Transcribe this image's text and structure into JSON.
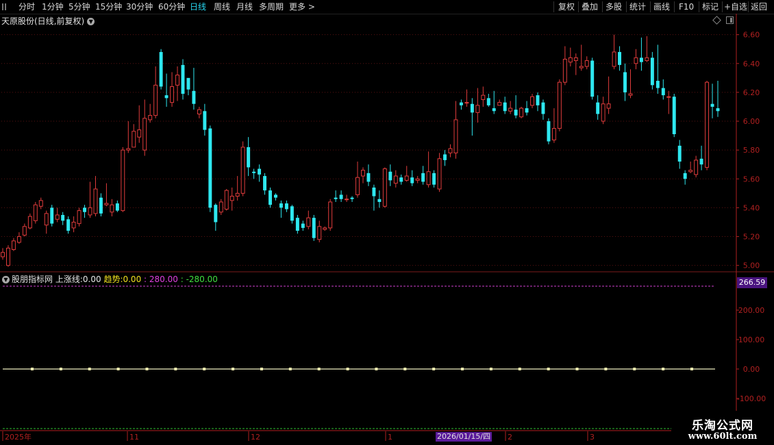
{
  "toolbar": {
    "left": [
      {
        "id": "fenshi",
        "label": "分时"
      },
      {
        "id": "1min",
        "label": "1分钟"
      },
      {
        "id": "5min",
        "label": "5分钟"
      },
      {
        "id": "15min",
        "label": "15分钟"
      },
      {
        "id": "30min",
        "label": "30分钟"
      },
      {
        "id": "60min",
        "label": "60分钟"
      },
      {
        "id": "day",
        "label": "日线",
        "active": true
      },
      {
        "id": "week",
        "label": "周线"
      },
      {
        "id": "month",
        "label": "月线"
      },
      {
        "id": "multi",
        "label": "多周期"
      },
      {
        "id": "more",
        "label": "更多 >"
      }
    ],
    "right": [
      {
        "id": "fuquan",
        "label": "复权"
      },
      {
        "id": "diejia",
        "label": "叠加"
      },
      {
        "id": "duogu",
        "label": "多股"
      },
      {
        "id": "tongji",
        "label": "统计"
      },
      {
        "id": "huaxian",
        "label": "画线"
      },
      {
        "id": "f10",
        "label": "F10"
      },
      {
        "id": "biaoji",
        "label": "标记"
      },
      {
        "id": "zixuan",
        "label": "+自选"
      },
      {
        "id": "fanhui",
        "label": "返回"
      }
    ]
  },
  "stock": {
    "title": "天原股份(日线,前复权)"
  },
  "indicator": {
    "name": "股朋指标网",
    "l1_label": "上涨线:",
    "l1_value": "0.00",
    "l2_label": "趋势:",
    "l2_value": "0.00",
    "l3_value": "280.00",
    "l4_value": "-280.00"
  },
  "indicator_tag": "266.59",
  "date_cursor": "2026/01/15/四",
  "watermark": {
    "title": "乐淘公式网",
    "url": "www.60lt.com"
  },
  "colors": {
    "up": "#e03c3c",
    "down": "#2ee8f0",
    "axis": "#b02020",
    "text": "#c8c8c8"
  },
  "chart_data": [
    {
      "type": "candlestick",
      "title": "",
      "y_ticks": [
        "6.60",
        "6.40",
        "6.20",
        "6.00",
        "5.80",
        "5.60",
        "5.40",
        "5.20",
        "5.00"
      ],
      "ylim": [
        4.97,
        6.66
      ],
      "x_labels": [
        "2025年",
        "11",
        "12",
        "1",
        "2",
        "3"
      ],
      "candles": [
        [
          5.06,
          5.09,
          5.04,
          5.12
        ],
        [
          5.0,
          5.12,
          4.99,
          5.14
        ],
        [
          5.11,
          5.17,
          5.1,
          5.19
        ],
        [
          5.16,
          5.2,
          5.15,
          5.23
        ],
        [
          5.21,
          5.27,
          5.2,
          5.29
        ],
        [
          5.26,
          5.34,
          5.25,
          5.36
        ],
        [
          5.31,
          5.42,
          5.29,
          5.44
        ],
        [
          5.41,
          5.45,
          5.39,
          5.47
        ],
        [
          5.28,
          5.36,
          5.22,
          5.38
        ],
        [
          5.4,
          5.29,
          5.27,
          5.42
        ],
        [
          5.32,
          5.35,
          5.3,
          5.4
        ],
        [
          5.35,
          5.31,
          5.28,
          5.37
        ],
        [
          5.32,
          5.24,
          5.22,
          5.34
        ],
        [
          5.26,
          5.3,
          5.23,
          5.34
        ],
        [
          5.29,
          5.38,
          5.27,
          5.4
        ],
        [
          5.4,
          5.37,
          5.33,
          5.42
        ],
        [
          5.35,
          5.4,
          5.33,
          5.58
        ],
        [
          5.36,
          5.53,
          5.34,
          5.62
        ],
        [
          5.47,
          5.36,
          5.34,
          5.5
        ],
        [
          5.42,
          5.43,
          5.41,
          5.57
        ],
        [
          5.37,
          5.42,
          5.34,
          5.46
        ],
        [
          5.43,
          5.38,
          5.37,
          5.45
        ],
        [
          5.38,
          5.8,
          5.37,
          5.82
        ],
        [
          5.8,
          5.81,
          5.78,
          6.0
        ],
        [
          5.82,
          5.93,
          5.82,
          5.98
        ],
        [
          5.89,
          5.94,
          5.85,
          6.11
        ],
        [
          5.8,
          6.02,
          5.76,
          6.15
        ],
        [
          6.01,
          6.04,
          5.99,
          6.12
        ],
        [
          6.04,
          6.25,
          6.02,
          6.38
        ],
        [
          6.48,
          6.24,
          6.22,
          6.5
        ],
        [
          6.18,
          6.16,
          6.1,
          6.33
        ],
        [
          6.13,
          6.24,
          6.1,
          6.34
        ],
        [
          6.25,
          6.32,
          6.14,
          6.38
        ],
        [
          6.39,
          6.19,
          6.15,
          6.43
        ],
        [
          6.3,
          6.22,
          6.18,
          6.26
        ],
        [
          6.21,
          6.12,
          6.08,
          6.37
        ],
        [
          6.05,
          6.08,
          6.02,
          6.1
        ],
        [
          6.07,
          5.94,
          5.9,
          6.12
        ],
        [
          5.95,
          5.4,
          5.37,
          5.97
        ],
        [
          5.42,
          5.3,
          5.24,
          5.43
        ],
        [
          5.37,
          5.44,
          5.35,
          5.46
        ],
        [
          5.39,
          5.52,
          5.38,
          5.53
        ],
        [
          5.45,
          5.48,
          5.38,
          5.54
        ],
        [
          5.48,
          5.5,
          5.45,
          5.62
        ],
        [
          5.5,
          5.82,
          5.48,
          5.86
        ],
        [
          5.82,
          5.68,
          5.62,
          5.89
        ],
        [
          5.65,
          5.64,
          5.6,
          5.67
        ],
        [
          5.67,
          5.63,
          5.58,
          5.7
        ],
        [
          5.62,
          5.52,
          5.49,
          5.64
        ],
        [
          5.52,
          5.42,
          5.4,
          5.54
        ],
        [
          5.49,
          5.47,
          5.45,
          5.5
        ],
        [
          5.43,
          5.4,
          5.33,
          5.45
        ],
        [
          5.43,
          5.39,
          5.37,
          5.45
        ],
        [
          5.41,
          5.31,
          5.29,
          5.42
        ],
        [
          5.33,
          5.24,
          5.22,
          5.35
        ],
        [
          5.29,
          5.26,
          5.24,
          5.31
        ],
        [
          5.27,
          5.33,
          5.25,
          5.38
        ],
        [
          5.33,
          5.19,
          5.17,
          5.35
        ],
        [
          5.18,
          5.27,
          5.16,
          5.31
        ],
        [
          5.25,
          5.26,
          5.24,
          5.27
        ],
        [
          5.26,
          5.44,
          5.24,
          5.46
        ],
        [
          5.47,
          5.46,
          5.44,
          5.52
        ],
        [
          5.49,
          5.46,
          5.44,
          5.52
        ],
        [
          5.46,
          5.46,
          5.44,
          5.49
        ],
        [
          5.47,
          5.46,
          5.44,
          5.48
        ],
        [
          5.49,
          5.61,
          5.47,
          5.72
        ],
        [
          5.62,
          5.66,
          5.57,
          5.68
        ],
        [
          5.64,
          5.58,
          5.55,
          5.7
        ],
        [
          5.54,
          5.48,
          5.38,
          5.56
        ],
        [
          5.46,
          5.44,
          5.4,
          5.52
        ],
        [
          5.41,
          5.67,
          5.4,
          5.68
        ],
        [
          5.65,
          5.59,
          5.55,
          5.7
        ],
        [
          5.57,
          5.62,
          5.54,
          5.66
        ],
        [
          5.61,
          5.58,
          5.56,
          5.63
        ],
        [
          5.59,
          5.62,
          5.58,
          5.69
        ],
        [
          5.61,
          5.57,
          5.55,
          5.66
        ],
        [
          5.59,
          5.6,
          5.57,
          5.62
        ],
        [
          5.64,
          5.58,
          5.56,
          5.69
        ],
        [
          5.56,
          5.65,
          5.54,
          5.79
        ],
        [
          5.64,
          5.56,
          5.54,
          5.66
        ],
        [
          5.53,
          5.74,
          5.51,
          5.78
        ],
        [
          5.77,
          5.73,
          5.69,
          5.8
        ],
        [
          5.78,
          5.81,
          5.75,
          5.84
        ],
        [
          5.78,
          6.01,
          5.74,
          6.14
        ],
        [
          6.13,
          6.11,
          6.08,
          6.15
        ],
        [
          6.13,
          6.13,
          6.1,
          6.22
        ],
        [
          6.12,
          6.06,
          5.9,
          6.16
        ],
        [
          6.06,
          6.11,
          5.99,
          6.23
        ],
        [
          6.15,
          6.18,
          6.1,
          6.24
        ],
        [
          6.16,
          6.11,
          6.1,
          6.19
        ],
        [
          6.09,
          6.07,
          6.05,
          6.21
        ],
        [
          6.11,
          6.13,
          6.11,
          6.15
        ],
        [
          6.13,
          6.07,
          6.05,
          6.17
        ],
        [
          6.07,
          6.09,
          6.05,
          6.14
        ],
        [
          6.08,
          6.04,
          6.02,
          6.18
        ],
        [
          6.03,
          6.09,
          6.02,
          6.1
        ],
        [
          6.09,
          6.06,
          6.04,
          6.14
        ],
        [
          6.11,
          6.17,
          6.09,
          6.19
        ],
        [
          6.18,
          6.11,
          6.07,
          6.2
        ],
        [
          6.13,
          6.05,
          6.01,
          6.15
        ],
        [
          6.0,
          5.86,
          5.84,
          6.02
        ],
        [
          5.87,
          5.95,
          5.85,
          6.09
        ],
        [
          5.95,
          6.27,
          5.93,
          6.29
        ],
        [
          6.27,
          6.43,
          6.25,
          6.52
        ],
        [
          6.41,
          6.44,
          6.38,
          6.51
        ],
        [
          6.42,
          6.44,
          6.32,
          6.47
        ],
        [
          6.37,
          6.38,
          6.35,
          6.53
        ],
        [
          6.38,
          6.42,
          6.36,
          6.45
        ],
        [
          6.42,
          6.17,
          6.15,
          6.44
        ],
        [
          6.13,
          6.05,
          6.01,
          6.18
        ],
        [
          6.0,
          6.12,
          5.98,
          6.17
        ],
        [
          6.09,
          6.12,
          6.05,
          6.31
        ],
        [
          6.38,
          6.48,
          6.36,
          6.6
        ],
        [
          6.48,
          6.39,
          6.35,
          6.52
        ],
        [
          6.34,
          6.2,
          6.14,
          6.4
        ],
        [
          6.18,
          6.19,
          6.16,
          6.36
        ],
        [
          6.4,
          6.44,
          6.36,
          6.5
        ],
        [
          6.44,
          6.41,
          6.35,
          6.58
        ],
        [
          6.42,
          6.44,
          6.41,
          6.59
        ],
        [
          6.44,
          6.25,
          6.22,
          6.48
        ],
        [
          6.28,
          6.23,
          6.19,
          6.53
        ],
        [
          6.23,
          6.18,
          6.15,
          6.29
        ],
        [
          6.17,
          6.17,
          6.05,
          6.21
        ],
        [
          6.17,
          5.91,
          5.89,
          6.19
        ],
        [
          5.83,
          5.72,
          5.67,
          5.87
        ],
        [
          5.64,
          5.6,
          5.56,
          5.66
        ],
        [
          5.65,
          5.66,
          5.64,
          5.72
        ],
        [
          5.63,
          5.73,
          5.61,
          5.76
        ],
        [
          5.74,
          5.7,
          5.66,
          5.83
        ],
        [
          5.68,
          6.27,
          5.66,
          6.28
        ],
        [
          6.12,
          6.1,
          6.02,
          6.26
        ],
        [
          6.09,
          6.07,
          6.03,
          6.28
        ]
      ]
    },
    {
      "type": "line",
      "title": "",
      "y_ticks": [
        "200.00",
        "100.00",
        "0.00",
        "-100.00"
      ],
      "ylim": [
        -200,
        300
      ],
      "series": [
        {
          "name": "上涨线",
          "values": [
            0,
            0,
            0,
            0,
            0,
            0,
            0,
            0,
            0,
            0,
            0,
            0,
            0,
            0,
            0,
            0,
            0,
            0,
            0,
            0,
            0,
            0,
            0,
            0
          ]
        }
      ]
    }
  ]
}
